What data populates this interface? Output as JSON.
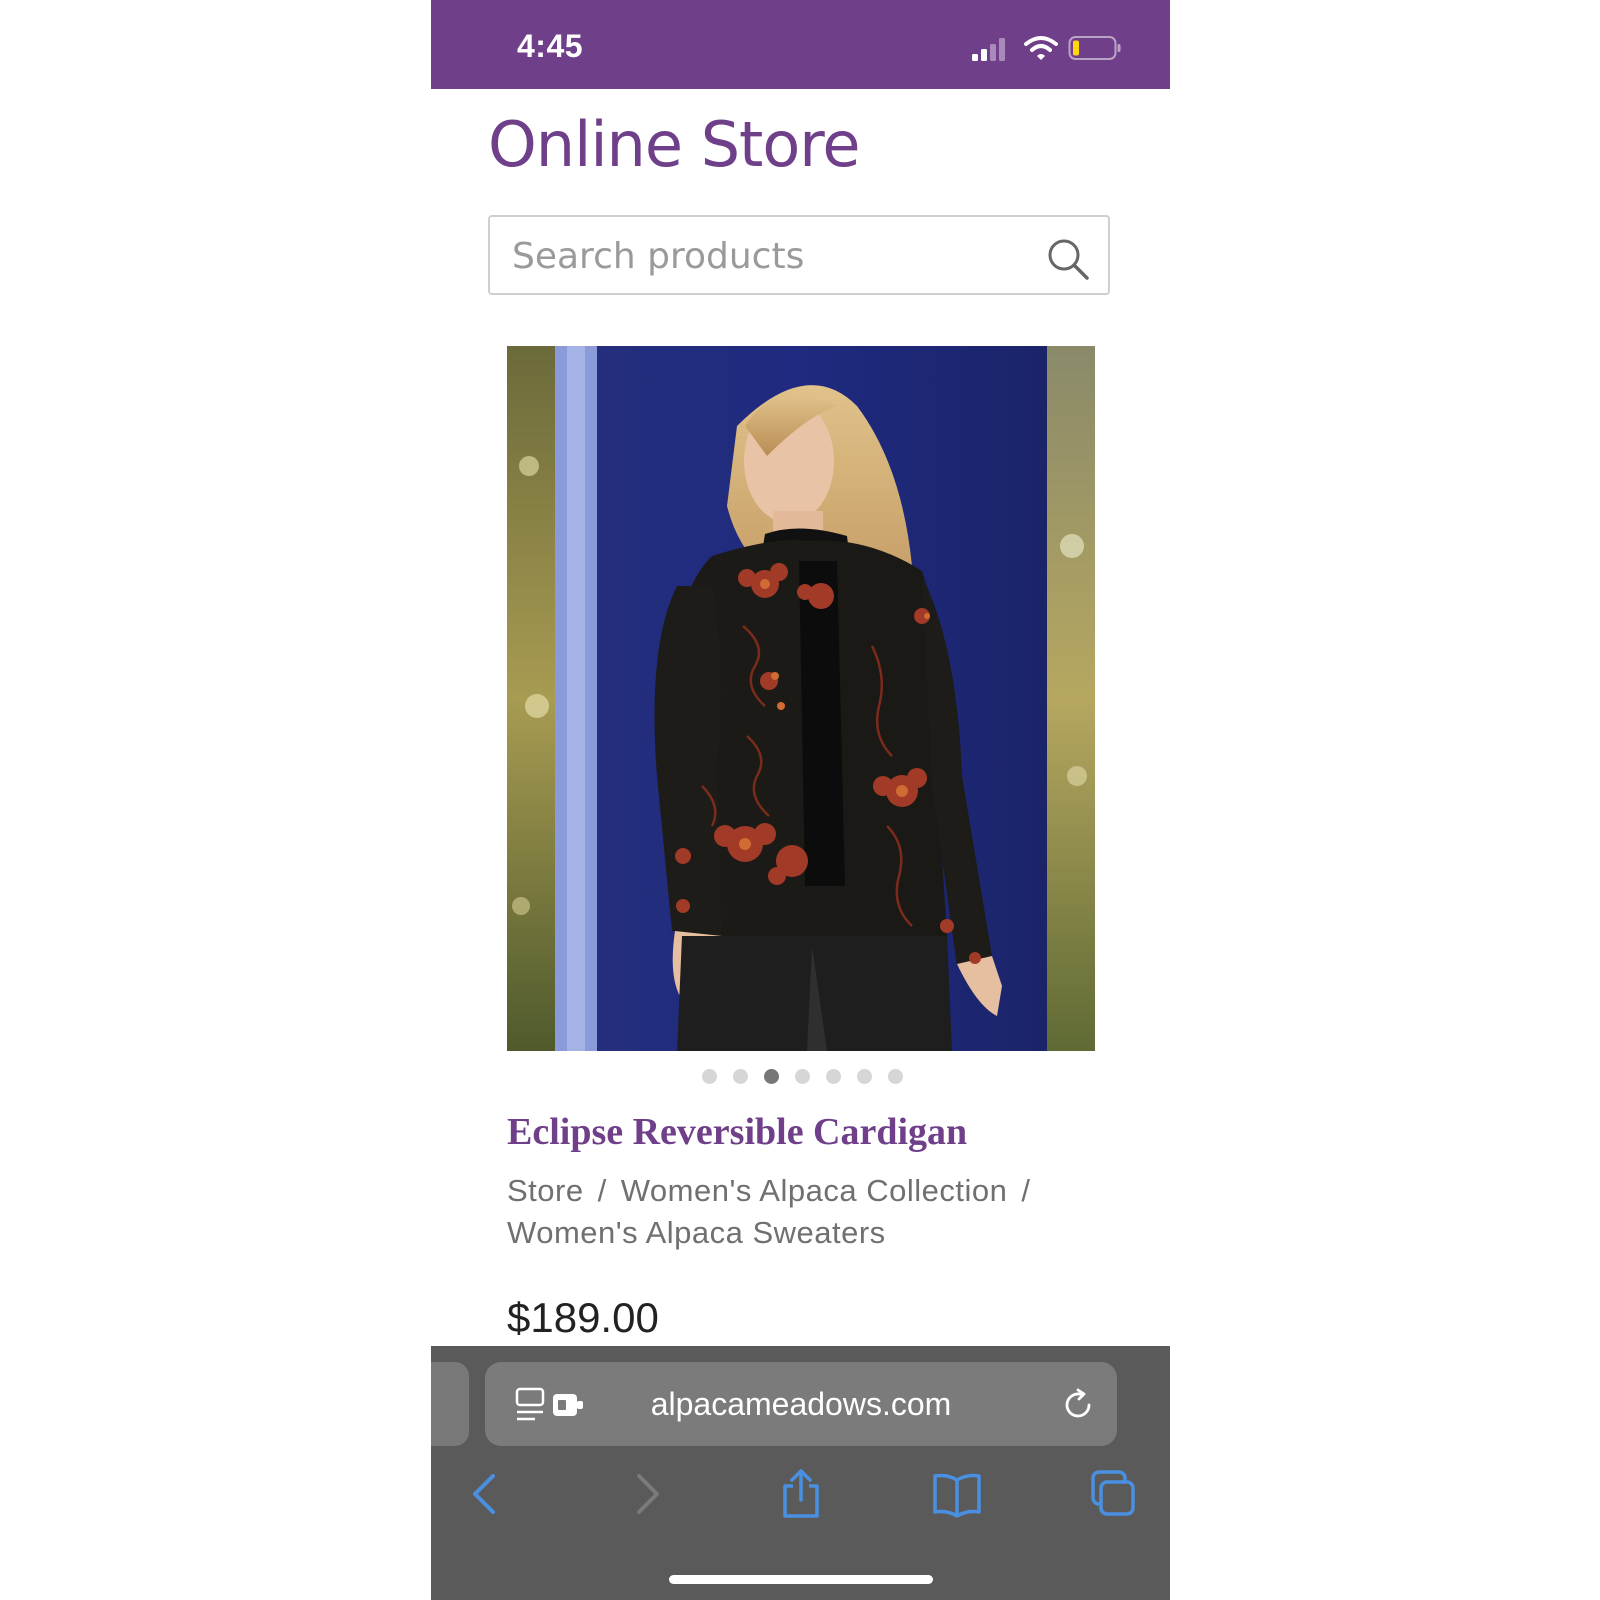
{
  "status_bar": {
    "time": "4:45",
    "icons": [
      "signal-icon",
      "wifi-icon",
      "battery-icon"
    ],
    "background": "#6f3f8a"
  },
  "store": {
    "title": "Online Store",
    "search_placeholder": "Search products"
  },
  "product": {
    "image_icon": "product-photo",
    "carousel_dots": 7,
    "active_dot": 3,
    "name": "Eclipse Reversible Cardigan",
    "breadcrumb": [
      "Store",
      "Women's Alpaca Collection",
      "Women's Alpaca Sweaters"
    ],
    "breadcrumb_separator": "/",
    "price": "$189.00"
  },
  "browser": {
    "url": "alpacameadows.com",
    "accent": "#4a90e2",
    "nav_icons": [
      "back-icon",
      "forward-icon",
      "share-icon",
      "bookmarks-icon",
      "tabs-icon"
    ]
  },
  "colors": {
    "brand_purple": "#6f3f8a",
    "toolbar_gray": "#5a5a5a"
  }
}
